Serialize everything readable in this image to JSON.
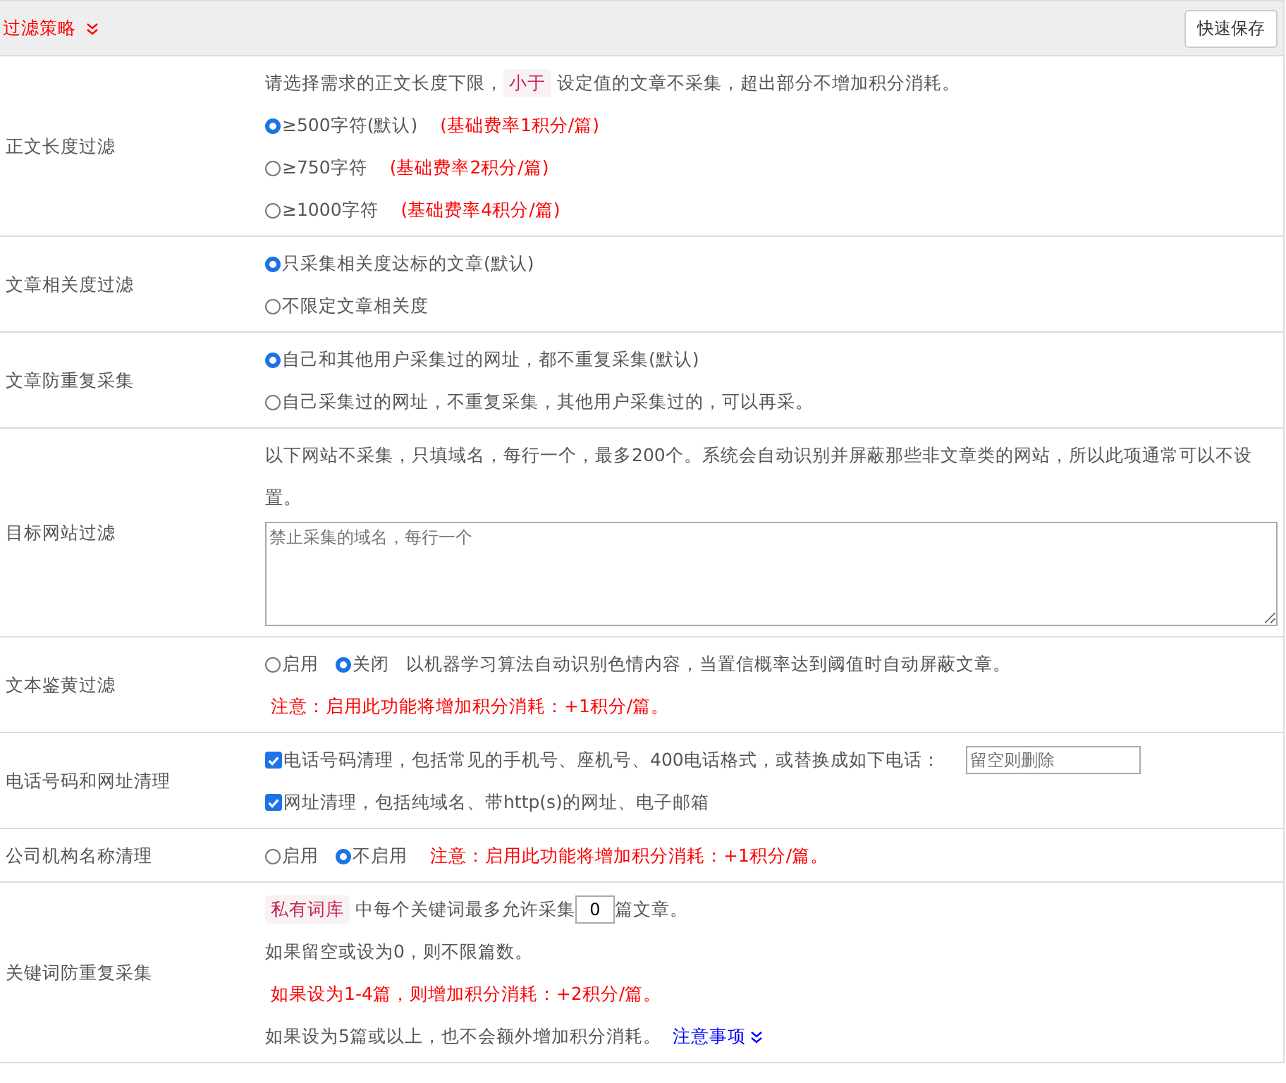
{
  "header": {
    "title": "过滤策略",
    "save_button": "快速保存"
  },
  "rows": [
    {
      "label": "正文长度过滤",
      "lines": [
        [
          {
            "kind": "text",
            "text": "请选择需求的正文长度下限，"
          },
          {
            "kind": "tag",
            "text": "小于"
          },
          {
            "kind": "text",
            "text": "设定值的文章不采集，超出部分不增加积分消耗。"
          }
        ],
        [
          {
            "kind": "radio",
            "text": "≥500字符(默认)",
            "selected": true
          },
          {
            "kind": "warn",
            "text": "(基础费率1积分/篇)"
          }
        ],
        [
          {
            "kind": "radio",
            "text": "≥750字符",
            "selected": false
          },
          {
            "kind": "warn",
            "text": "(基础费率2积分/篇)"
          }
        ],
        [
          {
            "kind": "radio",
            "text": "≥1000字符",
            "selected": false
          },
          {
            "kind": "warn",
            "text": "(基础费率4积分/篇)"
          }
        ]
      ]
    },
    {
      "label": "文章相关度过滤",
      "lines": [
        [
          {
            "kind": "radio",
            "text": "只采集相关度达标的文章(默认)",
            "selected": true
          }
        ],
        [
          {
            "kind": "radio",
            "text": "不限定文章相关度",
            "selected": false
          }
        ]
      ]
    },
    {
      "label": "文章防重复采集",
      "lines": [
        [
          {
            "kind": "radio",
            "text": "自己和其他用户采集过的网址，都不重复采集(默认)",
            "selected": true
          }
        ],
        [
          {
            "kind": "radio",
            "text": "自己采集过的网址，不重复采集，其他用户采集过的，可以再采。",
            "selected": false
          }
        ]
      ]
    },
    {
      "label": "目标网站过滤",
      "lines": [
        [
          {
            "kind": "text",
            "text": "以下网站不采集，只填域名，每行一个，最多200个。系统会自动识别并屏蔽那些非文章类的网站，所以此项通常可以不设置。"
          }
        ],
        [
          {
            "kind": "textarea",
            "placeholder": "禁止采集的域名，每行一个"
          }
        ]
      ]
    },
    {
      "label": "文本鉴黄过滤",
      "lines": [
        [
          {
            "kind": "radio",
            "text": "启用",
            "selected": false
          },
          {
            "kind": "radio",
            "text": "关闭",
            "selected": true
          },
          {
            "kind": "text",
            "text": "以机器学习算法自动识别色情内容，当置信概率达到阈值时自动屏蔽文章。"
          }
        ],
        [
          {
            "kind": "warn",
            "text": "注意：启用此功能将增加积分消耗：+1积分/篇。"
          }
        ]
      ]
    },
    {
      "label": "电话号码和网址清理",
      "lines": [
        [
          {
            "kind": "checkbox",
            "text": "电话号码清理，包括常见的手机号、座机号、400电话格式，或替换成如下电话：",
            "checked": true
          },
          {
            "kind": "input",
            "placeholder": "留空则删除"
          }
        ],
        [
          {
            "kind": "checkbox",
            "text": "网址清理，包括纯域名、带http(s)的网址、电子邮箱",
            "checked": true
          }
        ]
      ]
    },
    {
      "label": "公司机构名称清理",
      "lines": [
        [
          {
            "kind": "radio",
            "text": "启用",
            "selected": false
          },
          {
            "kind": "radio",
            "text": "不启用",
            "selected": true
          },
          {
            "kind": "warn",
            "text": "注意：启用此功能将增加积分消耗：+1积分/篇。"
          }
        ]
      ]
    },
    {
      "label": "关键词防重复采集",
      "lines": [
        [
          {
            "kind": "tag",
            "text": "私有词库"
          },
          {
            "kind": "text",
            "text": "中每个关键词最多允许采集"
          },
          {
            "kind": "number",
            "value": "0"
          },
          {
            "kind": "text",
            "text": "篇文章。"
          }
        ],
        [
          {
            "kind": "text",
            "text": "如果留空或设为0，则不限篇数。"
          }
        ],
        [
          {
            "kind": "warn",
            "text": "如果设为1-4篇，则增加积分消耗：+2积分/篇。"
          }
        ],
        [
          {
            "kind": "text",
            "text": "如果设为5篇或以上，也不会额外增加积分消耗。"
          },
          {
            "kind": "link",
            "text": "注意事项"
          }
        ]
      ]
    }
  ]
}
